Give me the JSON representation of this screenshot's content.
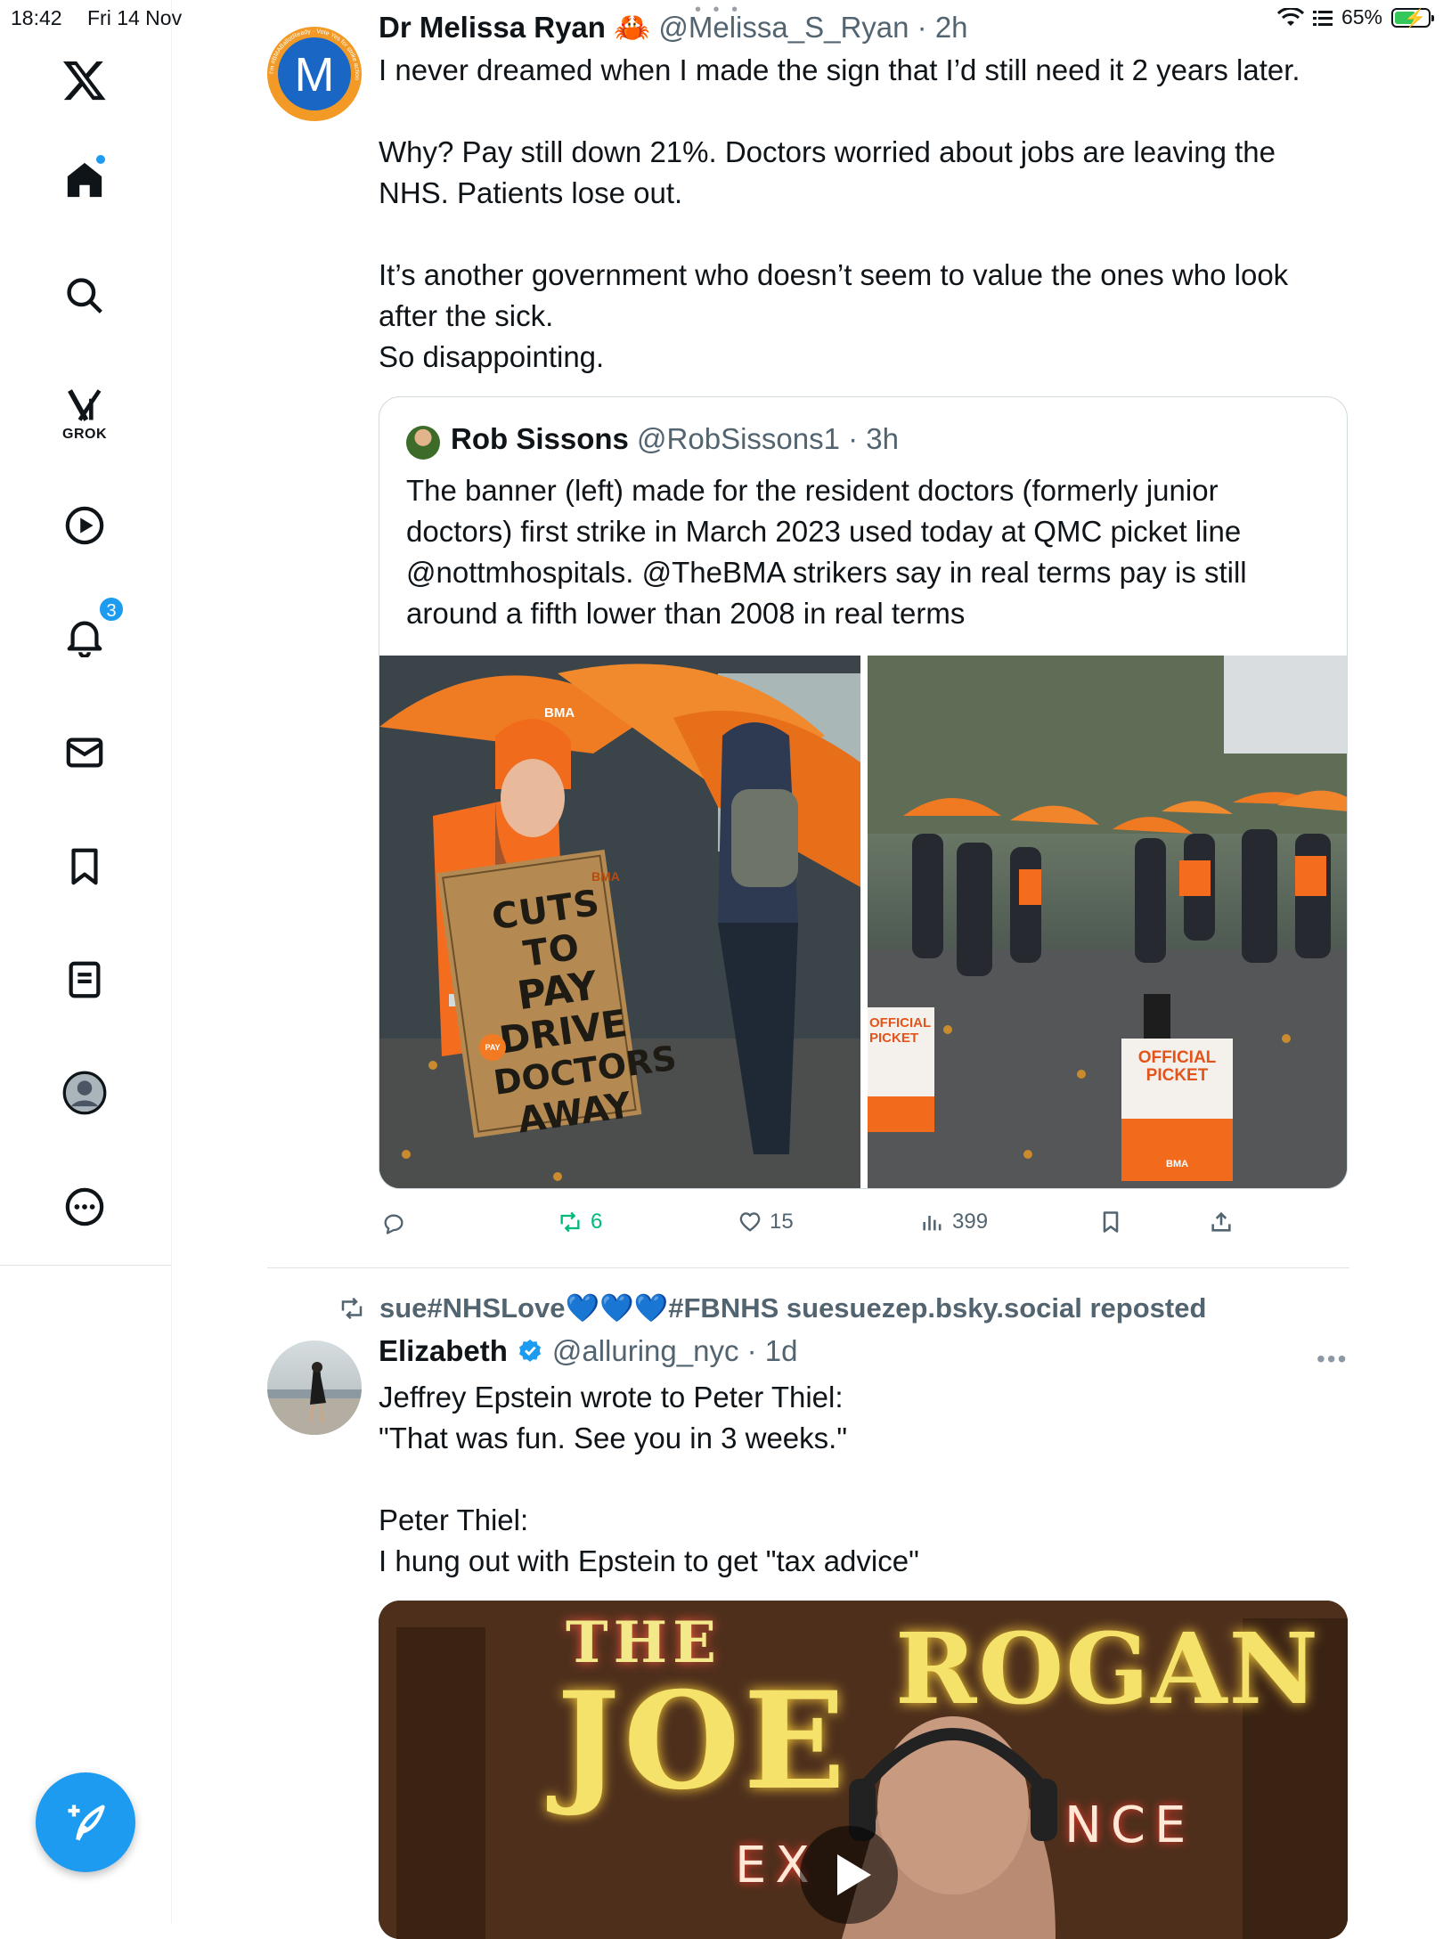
{
  "status_bar": {
    "time": "18:42",
    "date": "Fri 14 Nov",
    "battery": "65%",
    "battery_level": 0.65
  },
  "sidebar": {
    "grok_label": "GROK",
    "notifications_count": "3",
    "icons": [
      "x-logo-icon",
      "home-icon",
      "search-icon",
      "grok-icon",
      "video-icon",
      "bell-icon",
      "mail-icon",
      "bookmark-icon",
      "list-icon",
      "profile-icon",
      "more-icon",
      "compose-icon"
    ]
  },
  "tweet1": {
    "name": "Dr Melissa Ryan 🦀",
    "handle": "@Melissa_S_Ryan · 2h",
    "avatar_letter": "M",
    "avatar_ring_text": "I'm #BMABallotReady · Vote Yes for strike action",
    "text": "I never dreamed when I made the sign that I’d still need it 2 years later.\n\nWhy? Pay still down 21%. Doctors worried about jobs are leaving the NHS. Patients lose out.\n\nIt’s another government who doesn’t seem to value the ones who look after the sick.\n So disappointing.",
    "quote": {
      "name": "Rob Sissons",
      "handle": "@RobSissons1 · 3h",
      "text": "The banner (left) made for the resident doctors  (formerly junior doctors) first strike in March 2023 used today at QMC picket line @nottmhospitals. @TheBMA strikers say in real terms pay is still around a fifth lower than 2008 in real terms",
      "photo1": {
        "hat": "BMA",
        "vest": "BMA",
        "sign": [
          "CUTS TO",
          "PAY",
          "DRIVE",
          "DOCTORS",
          "AWAY"
        ],
        "sticker": "PAY"
      },
      "photo2": {
        "board1": [
          "OFFICIAL",
          "PICKET"
        ],
        "board2": [
          "OFFICIAL",
          "PICKET"
        ],
        "logo": "BMA"
      }
    },
    "actions": {
      "reposts": "6",
      "likes": "15",
      "views": "399"
    }
  },
  "tweet2": {
    "reposted_by": "sue#NHSLove💙💙💙#FBNHS suesuezep.bsky.social reposted",
    "name": "Elizabeth",
    "handle": "@alluring_nyc · 1d",
    "text": "Jeffrey Epstein wrote to Peter Thiel:\n\"That was fun. See you in 3 weeks.\"\n\nPeter Thiel:\nI hung out with Epstein to get \"tax advice\"",
    "video_sign": {
      "the": "THE",
      "joe": "JOE",
      "rogan": "ROGAN",
      "experience_left": "EX",
      "experience_right": "NCE"
    }
  },
  "colors": {
    "accent": "#1d9bf0",
    "repost_green": "#00ba7c",
    "muted": "#536471",
    "bma_orange": "#f26a1b"
  }
}
